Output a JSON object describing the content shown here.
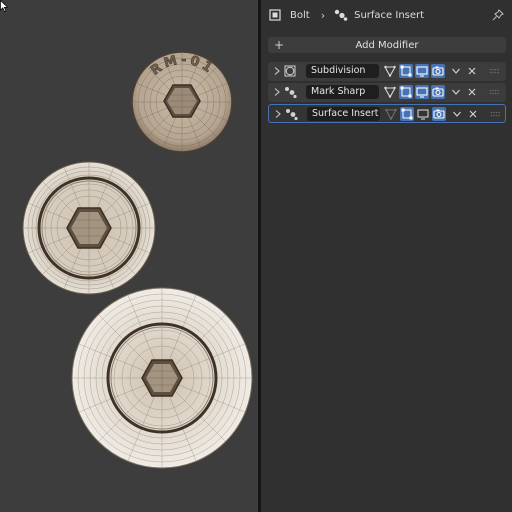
{
  "breadcrumb": {
    "object_name": "Bolt",
    "modifier_name": "Surface Insert",
    "object_icon": "object-icon",
    "modifier_icon": "modifier-icon",
    "pin_icon": "pin-icon"
  },
  "add_modifier": {
    "label": "Add Modifier",
    "icon": "plus-icon"
  },
  "modifiers": [
    {
      "name": "Subdivision",
      "type_icon": "subdivision-icon",
      "active": false,
      "viewport_on": true,
      "render_on": true
    },
    {
      "name": "Mark Sharp",
      "type_icon": "geometry-nodes-icon",
      "active": false,
      "viewport_on": true,
      "render_on": true
    },
    {
      "name": "Surface Insert",
      "type_icon": "geometry-nodes-icon",
      "active": true,
      "viewport_on": false,
      "render_on": true
    }
  ],
  "viewport": {
    "embossed_text": "RM-01",
    "colors": {
      "background": "#3d3d3d",
      "mesh": "#cbbfaf",
      "wire": "#5a4c3e"
    }
  },
  "colors": {
    "accent": "#4772b3",
    "panel_bg": "#303030",
    "field_bg": "#1e1e1e"
  }
}
